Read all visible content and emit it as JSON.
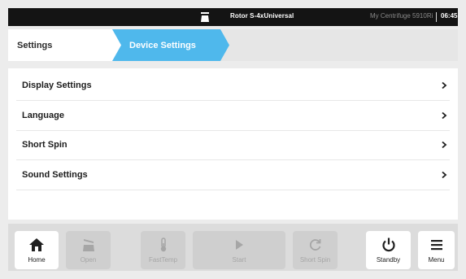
{
  "status_bar": {
    "rotor": "Rotor S-4xUniversal",
    "device": "My Centrifuge 5910Ri",
    "time": "06:45"
  },
  "breadcrumb": {
    "items": [
      {
        "label": "Settings"
      },
      {
        "label": "Device Settings"
      }
    ]
  },
  "settings_list": {
    "items": [
      {
        "label": "Display Settings"
      },
      {
        "label": "Language"
      },
      {
        "label": "Short Spin"
      },
      {
        "label": "Sound Settings"
      }
    ]
  },
  "toolbar": {
    "buttons": [
      {
        "label": "Home",
        "icon": "home-icon",
        "enabled": true
      },
      {
        "label": "Open",
        "icon": "lid-open-icon",
        "enabled": false
      },
      {
        "label": "FastTemp",
        "icon": "thermometer-icon",
        "enabled": false
      },
      {
        "label": "Start",
        "icon": "play-icon",
        "enabled": false
      },
      {
        "label": "Short Spin",
        "icon": "spin-icon",
        "enabled": false
      },
      {
        "label": "Standby",
        "icon": "power-icon",
        "enabled": true
      },
      {
        "label": "Menu",
        "icon": "menu-icon",
        "enabled": true
      }
    ]
  },
  "colors": {
    "accent": "#4fb8ec",
    "status_bar_bg": "#141414",
    "disabled_text": "#a6a6a6"
  }
}
